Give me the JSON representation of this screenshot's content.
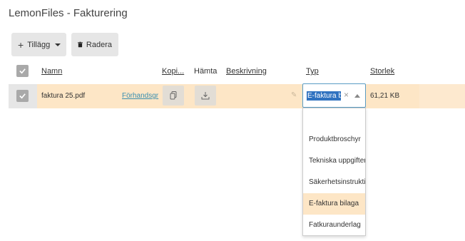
{
  "app": {
    "title": "LemonFiles - Fakturering"
  },
  "toolbar": {
    "add_label": "Tillägg",
    "delete_label": "Radera"
  },
  "table": {
    "headers": {
      "name": "Namn",
      "copy": "Kopi...",
      "download": "Hämta",
      "description": "Beskrivning",
      "type": "Typ",
      "size": "Storlek"
    },
    "row": {
      "name": "faktura 25.pdf",
      "preview": "Förhandsgr",
      "size": "61,21 KB",
      "type_value": "E-faktura bilaga"
    }
  },
  "type_dropdown": {
    "options": [
      "",
      "Produktbroschyr",
      "Tekniska uppgifter",
      "Säkerhetsinstruktioner",
      "E-faktura bilaga",
      "Fatkuraunderlag"
    ],
    "highlighted_index": 4
  },
  "colors": {
    "selected_row": "#fde6c6",
    "selection_highlight": "#3072c0",
    "link": "#3a8fb0"
  }
}
